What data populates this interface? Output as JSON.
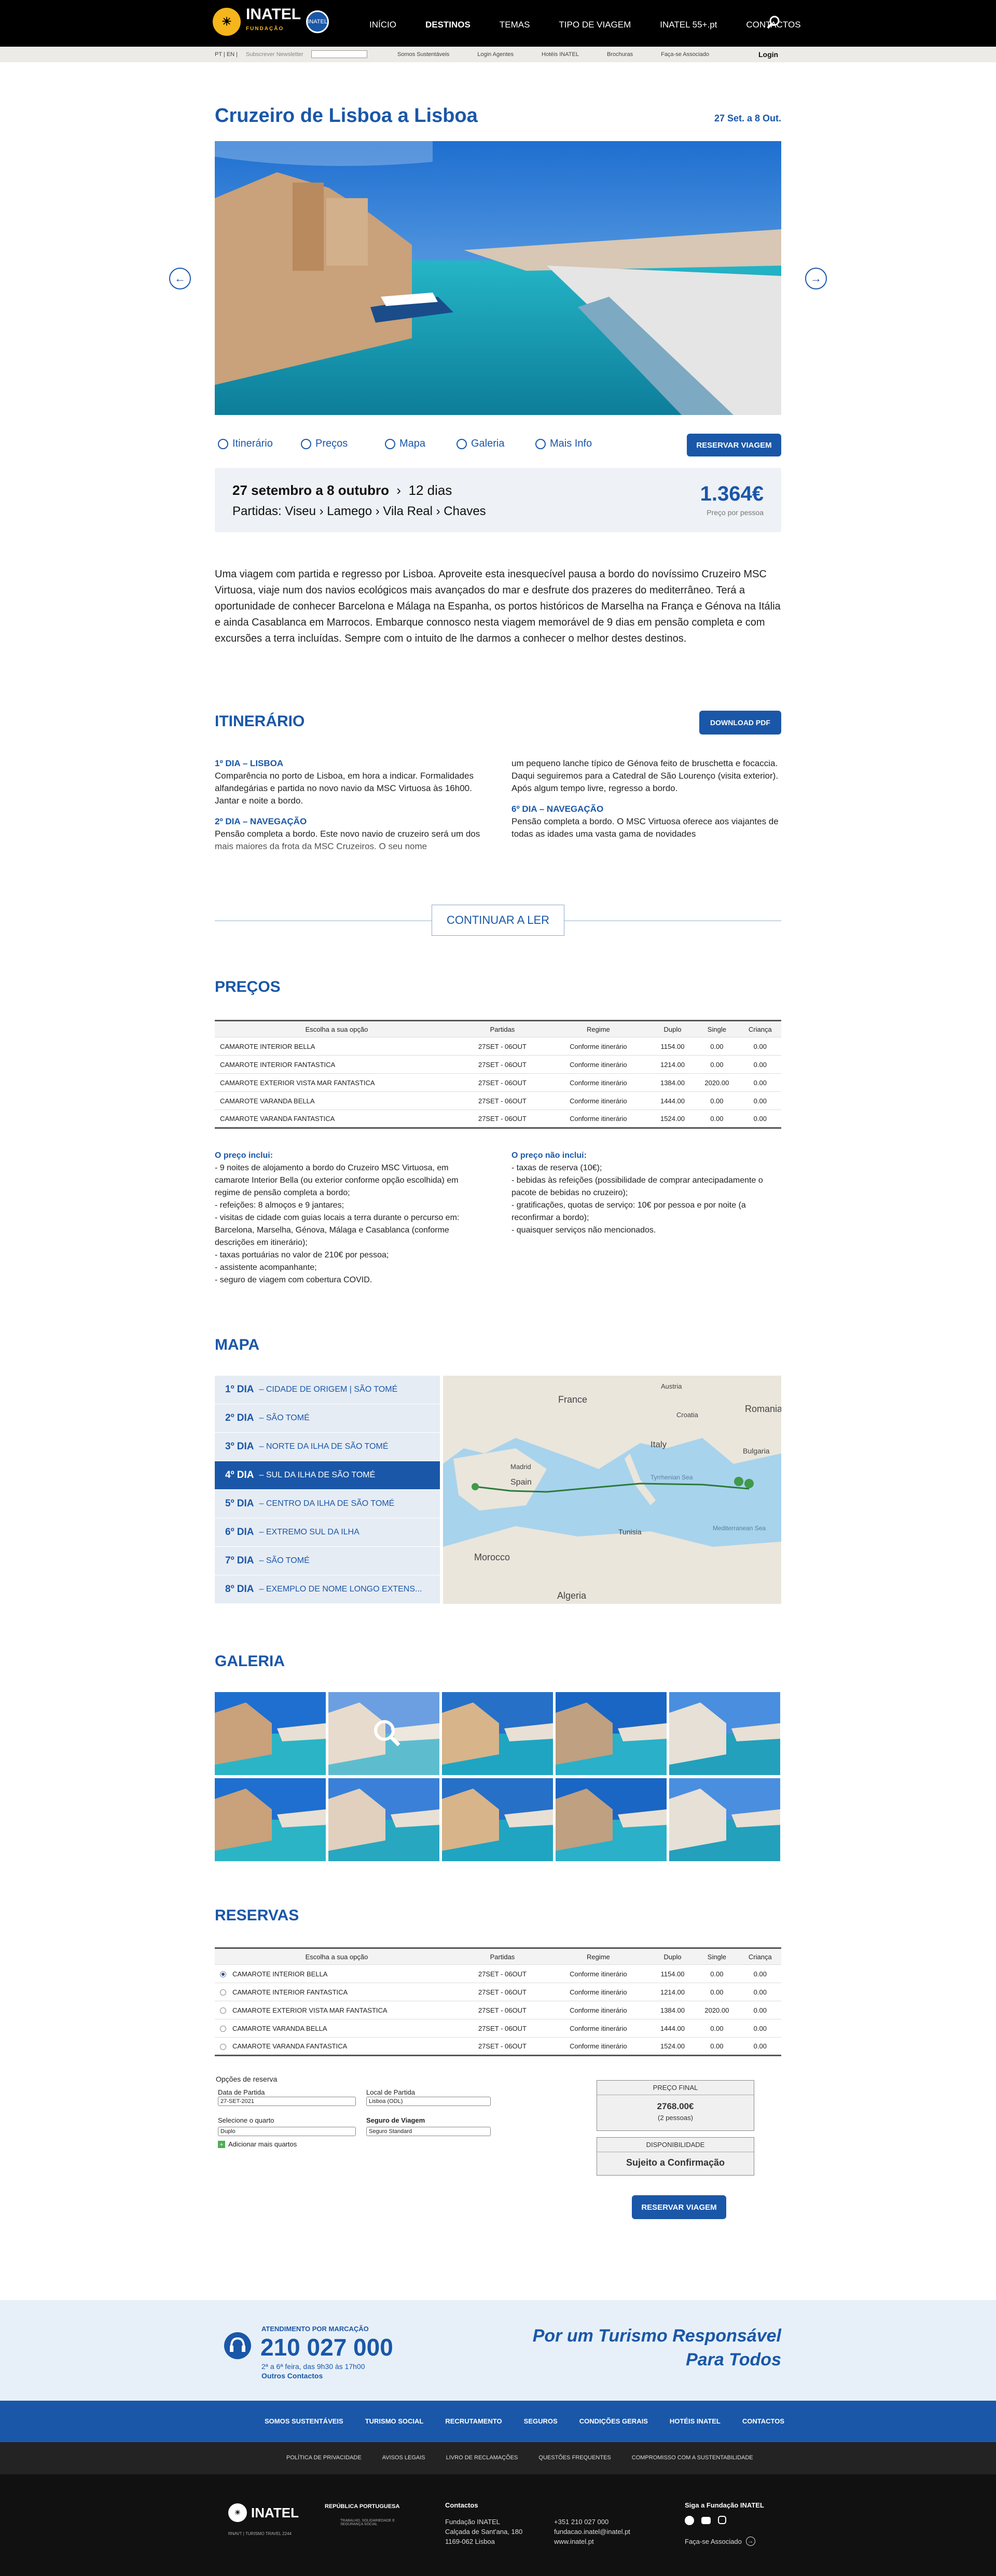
{
  "nav": {
    "brand": "INATEL",
    "brand_sub": "FUNDAÇÃO",
    "badge": "INATEL",
    "items": [
      "INÍCIO",
      "DESTINOS",
      "TEMAS",
      "TIPO DE VIAGEM",
      "INATEL 55+.pt",
      "CONTACTOS"
    ],
    "active": "DESTINOS"
  },
  "subnav": {
    "lang": "PT  |  EN  |",
    "newsletter": "Subscrever Newsletter",
    "links": [
      "Somos Sustentáveis",
      "Login Agentes",
      "Hotéis INATEL",
      "Brochuras",
      "Faça-se Associado"
    ],
    "login": "Login"
  },
  "trip": {
    "title": "Cruzeiro de Lisboa a Lisboa",
    "dates_short": "27 Set. a 8 Out.",
    "dates_long": "27 setembro a 8 outubro",
    "duration": "12 dias",
    "departures": "Partidas: Viseu › Lamego › Vila Real › Chaves",
    "price": "1.364€",
    "price_note": "Preço por pessoa"
  },
  "tabs": [
    "Itinerário",
    "Preços",
    "Mapa",
    "Galeria",
    "Mais Info"
  ],
  "reserve_label": "RESERVAR VIAGEM",
  "intro": "Uma viagem com partida e regresso por Lisboa. Aproveite esta inesquecível pausa a bordo do novíssimo Cruzeiro MSC Virtuosa, viaje num dos navios ecológicos mais avançados do mar e desfrute dos prazeres do mediterrâneo. Terá a oportunidade de conhecer Barcelona e Málaga na Espanha, os portos históricos de Marselha na França e Génova na Itália e ainda Casablanca em Marrocos. Embarque connosco nesta viagem memorável de 9 dias em pensão completa e com excursões a terra incluídas. Sempre com o intuito de lhe darmos a conhecer o melhor destes destinos.",
  "itinerary": {
    "title": "ITINERÁRIO",
    "download": "DOWNLOAD PDF",
    "day1_title": "1º DIA – LISBOA",
    "day1_text": "Comparência no porto de Lisboa, em hora a indicar. Formalidades alfandegárias e partida no novo navio da MSC Virtuosa às 16h00. Jantar e noite a bordo.",
    "day2_title": "2º DIA – NAVEGAÇÃO",
    "day2_text": "Pensão completa a bordo. Este novo navio de cruzeiro será um dos mais maiores da frota da MSC Cruzeiros. O seu nome",
    "col2_text": "um pequeno lanche típico de Génova feito de bruschetta e focaccia. Daqui seguiremos para a Catedral de São Lourenço (visita exterior). Após algum tempo livre, regresso a bordo.",
    "day6_title": "6º DIA – NAVEGAÇÃO",
    "day6_text": "Pensão completa a bordo. O MSC Virtuosa oferece aos viajantes de todas as idades uma vasta gama de novidades",
    "continue": "CONTINUAR A LER"
  },
  "prices": {
    "title": "PREÇOS",
    "headers": [
      "Escolha a sua opção",
      "Partidas",
      "Regime",
      "Duplo",
      "Single",
      "Criança"
    ],
    "rows": [
      [
        "CAMAROTE INTERIOR BELLA",
        "27SET - 06OUT",
        "Conforme itinerário",
        "1154.00",
        "0.00",
        "0.00"
      ],
      [
        "CAMAROTE INTERIOR FANTASTICA",
        "27SET - 06OUT",
        "Conforme itinerário",
        "1214.00",
        "0.00",
        "0.00"
      ],
      [
        "CAMAROTE EXTERIOR VISTA MAR FANTASTICA",
        "27SET - 06OUT",
        "Conforme itinerário",
        "1384.00",
        "2020.00",
        "0.00"
      ],
      [
        "CAMAROTE VARANDA BELLA",
        "27SET - 06OUT",
        "Conforme itinerário",
        "1444.00",
        "0.00",
        "0.00"
      ],
      [
        "CAMAROTE VARANDA FANTASTICA",
        "27SET - 06OUT",
        "Conforme itinerário",
        "1524.00",
        "0.00",
        "0.00"
      ]
    ],
    "includes_title": "O preço inclui:",
    "includes": [
      "- 9 noites de alojamento a bordo do Cruzeiro MSC Virtuosa, em camarote Interior Bella (ou exterior conforme opção escolhida) em regime de pensão completa a bordo;",
      "- refeições: 8 almoços e 9 jantares;",
      "- visitas de cidade com guias locais a terra durante o percurso em: Barcelona, Marselha, Génova, Málaga e Casablanca (conforme descrições em itinerário);",
      "- taxas portuárias no valor de 210€ por pessoa;",
      "- assistente acompanhante;",
      "- seguro de viagem com cobertura COVID."
    ],
    "excludes_title": "O preço não inclui:",
    "excludes": [
      "- taxas de reserva (10€);",
      "- bebidas às refeições (possibilidade de comprar antecipadamente o pacote de bebidas no cruzeiro);",
      "- gratificações, quotas de serviço: 10€ por pessoa e por noite (a reconfirmar a bordo);",
      "- quaisquer serviços não mencionados."
    ]
  },
  "map": {
    "title": "MAPA",
    "days": [
      [
        "1º DIA",
        "– CIDADE DE ORIGEM | SÃO TOMÉ"
      ],
      [
        "2º DIA",
        "– SÃO TOMÉ"
      ],
      [
        "3º DIA",
        "– NORTE DA ILHA DE SÃO TOMÉ"
      ],
      [
        "4º DIA",
        "– SUL DA ILHA DE SÃO TOMÉ"
      ],
      [
        "5º DIA",
        "– CENTRO DA ILHA DE SÃO TOMÉ"
      ],
      [
        "6º DIA",
        "– EXTREMO SUL DA ILHA"
      ],
      [
        "7º DIA",
        "– SÃO TOMÉ"
      ],
      [
        "8º DIA",
        "– EXEMPLO DE NOME LONGO EXTENS..."
      ]
    ],
    "labels": [
      "France",
      "Austria",
      "Croatia",
      "Romania",
      "Bulgaria",
      "Italy",
      "Madrid",
      "Spain",
      "Tyrrhenian Sea",
      "Tunisia",
      "Mediterranean Sea",
      "Morocco",
      "Algeria"
    ]
  },
  "gallery": {
    "title": "GALERIA"
  },
  "reservas": {
    "title": "RESERVAS",
    "options_title": "Opções de reserva",
    "date_label": "Data de Partida",
    "date_value": "27-SET-2021",
    "local_label": "Local de Partida",
    "local_value": "Lisboa (ODL)",
    "room_label": "Selecione o quarto",
    "room_value": "Duplo",
    "insurance_label": "Seguro de Viagem",
    "insurance_value": "Seguro Standard",
    "add_rooms": "Adicionar mais quartos",
    "final_price_label": "PREÇO FINAL",
    "final_price": "2768.00€",
    "persons": "(2 pessoas)",
    "availability_label": "DISPONIBILIDADE",
    "availability": "Sujeito a Confirmação"
  },
  "contact": {
    "label": "ATENDIMENTO POR MARCAÇÃO",
    "phone": "210 027 000",
    "hours": "2ª a 6ª feira, das 9h30 às 17h00",
    "other": "Outros Contactos",
    "slogan1": "Por um Turismo Responsável",
    "slogan2": "Para Todos"
  },
  "footnav": [
    "SOMOS SUSTENTÁVEIS",
    "TURISMO SOCIAL",
    "RECRUTAMENTO",
    "SEGUROS",
    "CONDIÇÕES GERAIS",
    "HOTÉIS INATEL",
    "CONTACTOS"
  ],
  "legal": [
    "POLÍTICA DE PRIVACIDADE",
    "AVISOS LEGAIS",
    "LIVRO DE RECLAMAÇÕES",
    "QUESTÕES FREQUENTES",
    "COMPROMISSO COM A SUSTENTABILIDADE"
  ],
  "footer": {
    "republic": "REPÚBLICA PORTUGUESA",
    "ministry": "TRABALHO, SOLIDARIEDADE E SEGURANÇA SOCIAL",
    "rnavt": "RNAVT | TURISMO TRAVEL 2244",
    "contacts_title": "Contactos",
    "org": "Fundação INATEL",
    "street": "Calçada de Sant'ana, 180",
    "city": "1169-062 Lisboa",
    "phone": "+351 210 027 000",
    "email": "fundacao.inatel@inatel.pt",
    "web": "www.inatel.pt",
    "follow": "Siga a Fundação INATEL",
    "member": "Faça-se Associado"
  }
}
